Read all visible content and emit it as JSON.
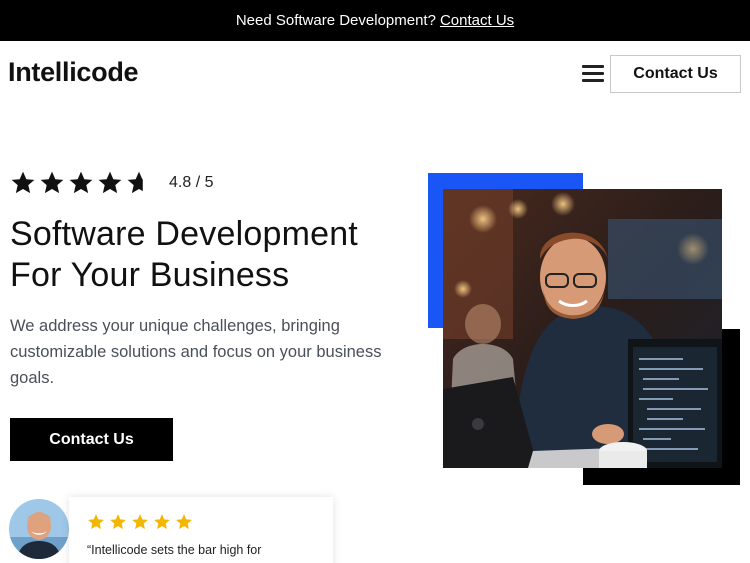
{
  "topbar": {
    "text": "Need Software Development?",
    "link": "Contact Us"
  },
  "header": {
    "logo": "Intellicode",
    "menu_icon": "hamburger-icon",
    "cta": "Contact Us"
  },
  "hero": {
    "rating": {
      "value": 4.8,
      "label": "4.8 / 5",
      "star_icon": "star-icon"
    },
    "title_line1": "Software Development",
    "title_line2": "For Your Business",
    "description": "We address your unique challenges, bringing customizable solutions and focus on your business goals.",
    "cta": "Contact Us",
    "image_icon": "developer-photo"
  },
  "testimonial": {
    "stars": 5,
    "quote": "“Intellicode sets the bar high for"
  },
  "colors": {
    "accent_blue": "#1a55f5",
    "star_gold": "#f2b705",
    "dark": "#000000"
  }
}
